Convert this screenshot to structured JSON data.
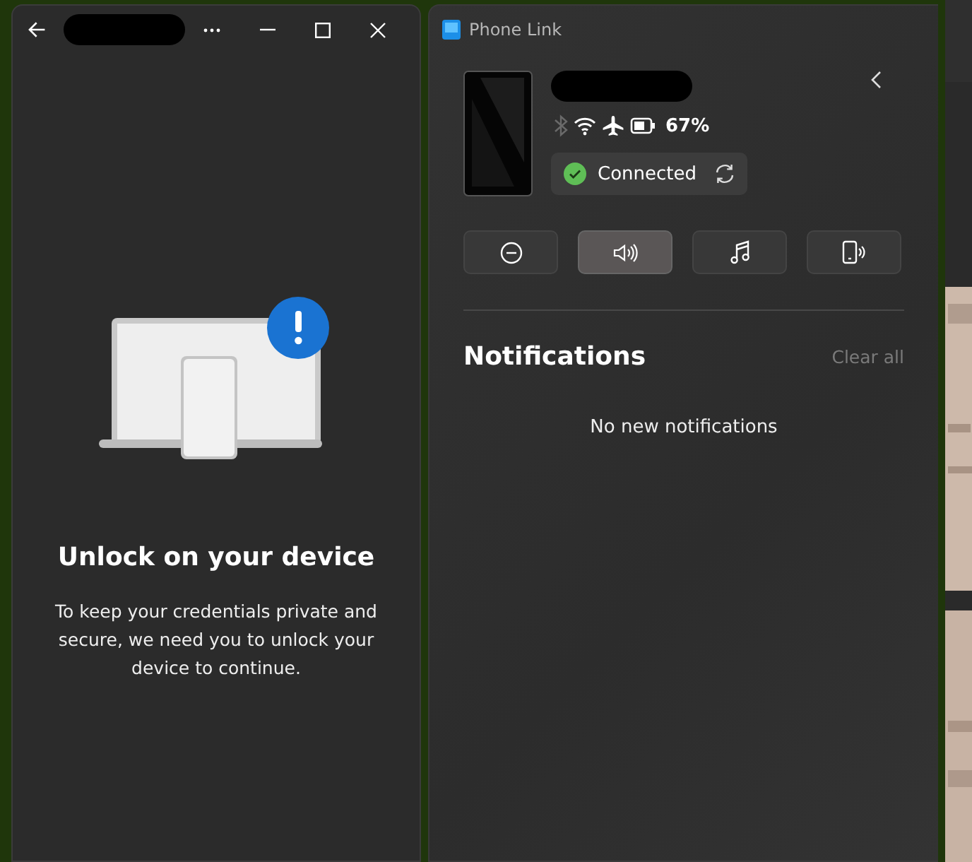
{
  "unlock_window": {
    "heading": "Unlock on your device",
    "message": "To keep your credentials private and secure, we need you to unlock your device to continue."
  },
  "phone_link": {
    "title": "Phone Link",
    "status_icons": [
      {
        "kind": "bluetooth",
        "on": false
      },
      {
        "kind": "wifi",
        "on": true
      },
      {
        "kind": "airplane",
        "on": true
      },
      {
        "kind": "battery",
        "on": true
      }
    ],
    "battery": "67%",
    "connection": {
      "label": "Connected",
      "connected": true
    },
    "quick_actions": [
      {
        "kind": "do-not-disturb",
        "selected": false
      },
      {
        "kind": "sound",
        "selected": true
      },
      {
        "kind": "music",
        "selected": false
      },
      {
        "kind": "phone-audio",
        "selected": false
      }
    ],
    "notifications": {
      "title": "Notifications",
      "clear": "Clear all",
      "empty": "No new notifications"
    }
  }
}
